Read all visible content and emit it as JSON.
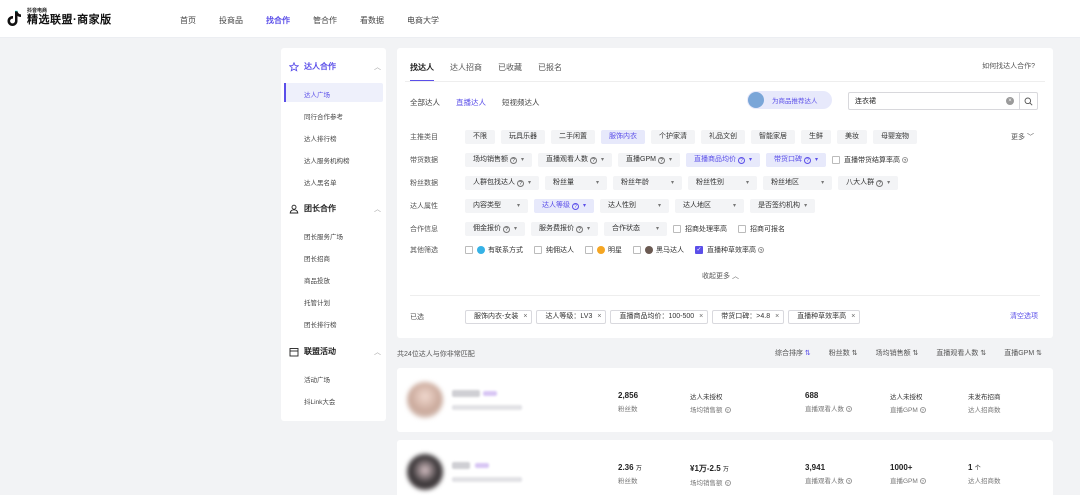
{
  "header": {
    "logo_sub": "抖音电商",
    "logo_main": "精选联盟·商家版",
    "nav": [
      "首页",
      "投商品",
      "找合作",
      "管合作",
      "看数据",
      "电商大学"
    ],
    "active_nav": "找合作"
  },
  "sidebar": {
    "sections": [
      {
        "title": "达人合作",
        "items": [
          "达人广场",
          "同行合作参考",
          "达人排行榜",
          "达人服务机构榜",
          "达人黑名单"
        ]
      },
      {
        "title": "团长合作",
        "items": [
          "团长服务广场",
          "团长招商",
          "商品投放",
          "托管计划",
          "团长排行榜"
        ]
      },
      {
        "title": "联盟活动",
        "items": [
          "活动广场",
          "抖Link大会"
        ]
      }
    ],
    "active_item": "达人广场"
  },
  "tabs": [
    "找达人",
    "达人招商",
    "已收藏",
    "已报名"
  ],
  "help_link": "如何找达人合作?",
  "subtabs": [
    "全部达人",
    "直播达人",
    "短视频达人"
  ],
  "recommend_label": "为商品推荐达人",
  "search": {
    "value": "连衣裙"
  },
  "filters": {
    "category": {
      "label": "主推类目",
      "options": [
        "不限",
        "玩具乐器",
        "二手闲置",
        "服饰内衣",
        "个护家清",
        "礼品文创",
        "智能家居",
        "生鲜",
        "美妆",
        "母婴宠物"
      ],
      "selected": "服饰内衣",
      "more": "更多"
    },
    "sales": {
      "label": "带货数据",
      "options": [
        "场均销售额",
        "直播观看人数",
        "直播GPM",
        "直播商品均价",
        "带货口碑"
      ],
      "checkbox": "直播带货结算率高"
    },
    "fans": {
      "label": "粉丝数据",
      "options": [
        "人群包找达人",
        "粉丝量",
        "粉丝年龄",
        "粉丝性别",
        "粉丝地区",
        "八大人群"
      ]
    },
    "attr": {
      "label": "达人属性",
      "options": [
        "内容类型",
        "达人等级",
        "达人性别",
        "达人地区",
        "是否签约机构"
      ]
    },
    "coop": {
      "label": "合作信息",
      "options": [
        "佣金报价",
        "服务费报价",
        "合作状态"
      ],
      "checkboxes": [
        "招商处理率高",
        "招商可报名"
      ]
    },
    "other": {
      "label": "其他筛选",
      "checkboxes": [
        "有联系方式",
        "纯佣达人",
        "明星",
        "黑马达人",
        "直播种草效率高"
      ]
    },
    "collapse": "收起更多"
  },
  "chosen": {
    "label": "已选",
    "tags": [
      "服饰内衣-女装",
      "达人等级：LV3",
      "直播商品均价：100-500",
      "带货口碑：>4.8",
      "直播种草效率高"
    ],
    "clear": "清空选项"
  },
  "results": {
    "count_text": "共24位达人与你非常匹配",
    "sorts": [
      "综合排序",
      "粉丝数",
      "场均销售额",
      "直播观看人数",
      "直播GPM"
    ],
    "rows": [
      {
        "fans": "2,856",
        "fans_unit": "",
        "fans_label": "粉丝数",
        "sales": "达人未授权",
        "sales_unit": "",
        "sales_label": "场均销售额",
        "viewers": "688",
        "viewers_label": "直播观看人数",
        "gpm": "达人未授权",
        "gpm_label": "直播GPM",
        "recruit": "未发布招商",
        "recruit_label": "达人招商数"
      },
      {
        "fans": "2.36",
        "fans_unit": "万",
        "fans_label": "粉丝数",
        "sales": "¥1万-2.5",
        "sales_unit": "万",
        "sales_label": "场均销售额",
        "viewers": "3,941",
        "viewers_label": "直播观看人数",
        "gpm": "1000+",
        "gpm_label": "直播GPM",
        "recruit": "1",
        "recruit_unit": "个",
        "recruit_label": "达人招商数"
      }
    ]
  },
  "colors": {
    "accent": "#5b4fe9",
    "background": "#f2f3f5"
  }
}
